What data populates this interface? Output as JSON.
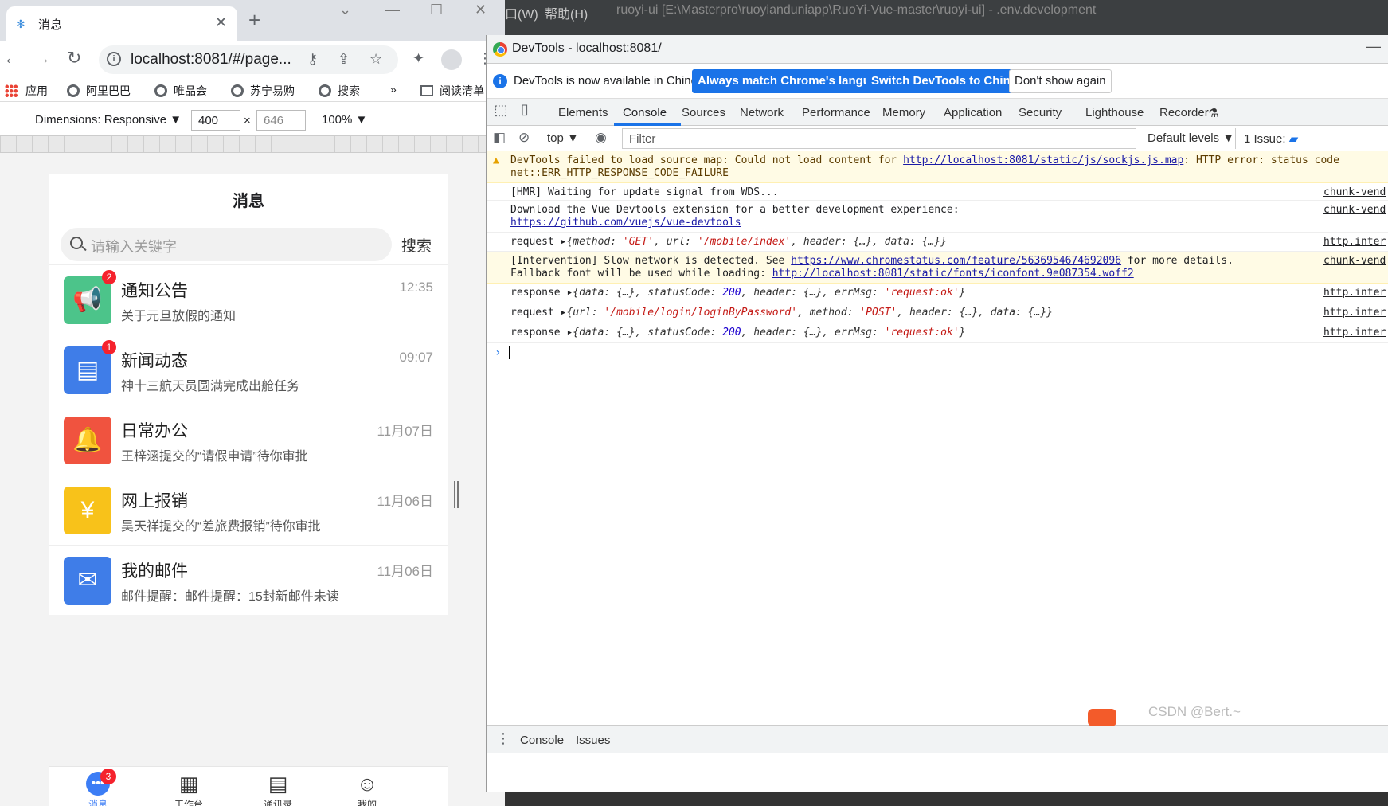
{
  "browser": {
    "tab_title": "消息",
    "url": "localhost:8081/#/page...",
    "bookmarks": [
      "应用",
      "阿里巴巴",
      "唯品会",
      "苏宁易购",
      "搜索",
      "阅读清单"
    ],
    "bookmarks_more": "»"
  },
  "device_toolbar": {
    "dimensions_label": "Dimensions: Responsive ▼",
    "width": "400",
    "height": "646",
    "times": "×",
    "zoom": "100% ▼"
  },
  "phone": {
    "title": "消息",
    "search_placeholder": "请输入关键字",
    "search_button": "搜索",
    "messages": [
      {
        "name": "通知公告",
        "time": "12:35",
        "desc": "关于元旦放假的通知",
        "badge": "2",
        "color": "#4cc48a",
        "icon": "megaphone-icon",
        "glyph": "📢"
      },
      {
        "name": "新闻动态",
        "time": "09:07",
        "desc": "神十三航天员圆满完成出舱任务",
        "badge": "1",
        "color": "#3f7de8",
        "icon": "newspaper-icon",
        "glyph": "▤"
      },
      {
        "name": "日常办公",
        "time": "11月07日",
        "desc": "王梓涵提交的“请假申请”待你审批",
        "badge": "",
        "color": "#f0533f",
        "icon": "bell-icon",
        "glyph": "🔔"
      },
      {
        "name": "网上报销",
        "time": "11月06日",
        "desc": "吴天祥提交的“差旅费报销”待你审批",
        "badge": "",
        "color": "#f8c21a",
        "icon": "ticket-icon",
        "glyph": "¥"
      },
      {
        "name": "我的邮件",
        "time": "11月06日",
        "desc": "邮件提醒：邮件提醒：15封新邮件未读",
        "badge": "",
        "color": "#3f7de8",
        "icon": "mail-icon",
        "glyph": "✉"
      }
    ],
    "tabbar": [
      {
        "label": "消息",
        "icon": "chat-icon",
        "glyph": "•••",
        "badge": "3"
      },
      {
        "label": "工作台",
        "icon": "grid-icon",
        "glyph": "▦",
        "badge": ""
      },
      {
        "label": "通讯录",
        "icon": "contacts-icon",
        "glyph": "▤",
        "badge": ""
      },
      {
        "label": "我的",
        "icon": "user-icon",
        "glyph": "☺",
        "badge": ""
      }
    ]
  },
  "editor": {
    "menu_window": "口(W)",
    "menu_help": "帮助(H)",
    "title": "ruoyi-ui [E:\\Masterpro\\ruoyianduniapp\\RuoYi-Vue-master\\ruoyi-ui] - .env.development"
  },
  "devtools": {
    "window_title": "DevTools - localhost:8081/",
    "info_message": "DevTools is now available in Chinese!",
    "btn_match": "Always match Chrome's language",
    "btn_switch": "Switch DevTools to Chinese",
    "btn_dont_show": "Don't show again",
    "panels": [
      "Elements",
      "Console",
      "Sources",
      "Network",
      "Performance",
      "Memory",
      "Application",
      "Security",
      "Lighthouse",
      "Recorder"
    ],
    "context": "top ▼",
    "filter_placeholder": "Filter",
    "levels": "Default levels ▼",
    "issues": "1 Issue:",
    "drawer_tabs": [
      "Console",
      "Issues"
    ],
    "console": {
      "warn1_line1": "DevTools failed to load source map: Could not load content for ",
      "warn1_link": "http://localhost:8081/static/js/sockjs.js.map",
      "warn1_tail": ": HTTP error: status code",
      "warn1_line2": "net::ERR_HTTP_RESPONSE_CODE_FAILURE",
      "hmr": "[HMR] Waiting for update signal from WDS...",
      "hmr_src": "chunk-vend",
      "vue_line1": "Download the Vue Devtools extension for a better development experience:",
      "vue_link": "https://github.com/vuejs/vue-devtools",
      "vue_src": "chunk-vend",
      "req1_key": "request",
      "req1_method": "'GET'",
      "req1_url": "'/mobile/index'",
      "req1_src": "http.inter",
      "interv_line1_a": "[Intervention] Slow network is detected. See ",
      "interv_link1": "https://www.chromestatus.com/feature/5636954674692096",
      "interv_line1_b": " for more details.",
      "interv_line2_a": "Fallback font will be used while loading: ",
      "interv_link2": "http://localhost:8081/static/fonts/iconfont.9e087354.woff2",
      "interv_src": "chunk-vend",
      "resp1_key": "response",
      "resp_status": "200",
      "resp_msg": "'request:ok'",
      "resp_src": "http.inter",
      "req2_key": "request",
      "req2_url": "'/mobile/login/loginByPassword'",
      "req2_method": "'POST'",
      "req2_src": "http.inter",
      "resp2_key": "response"
    }
  },
  "watermark": "CSDN @Bert.~"
}
